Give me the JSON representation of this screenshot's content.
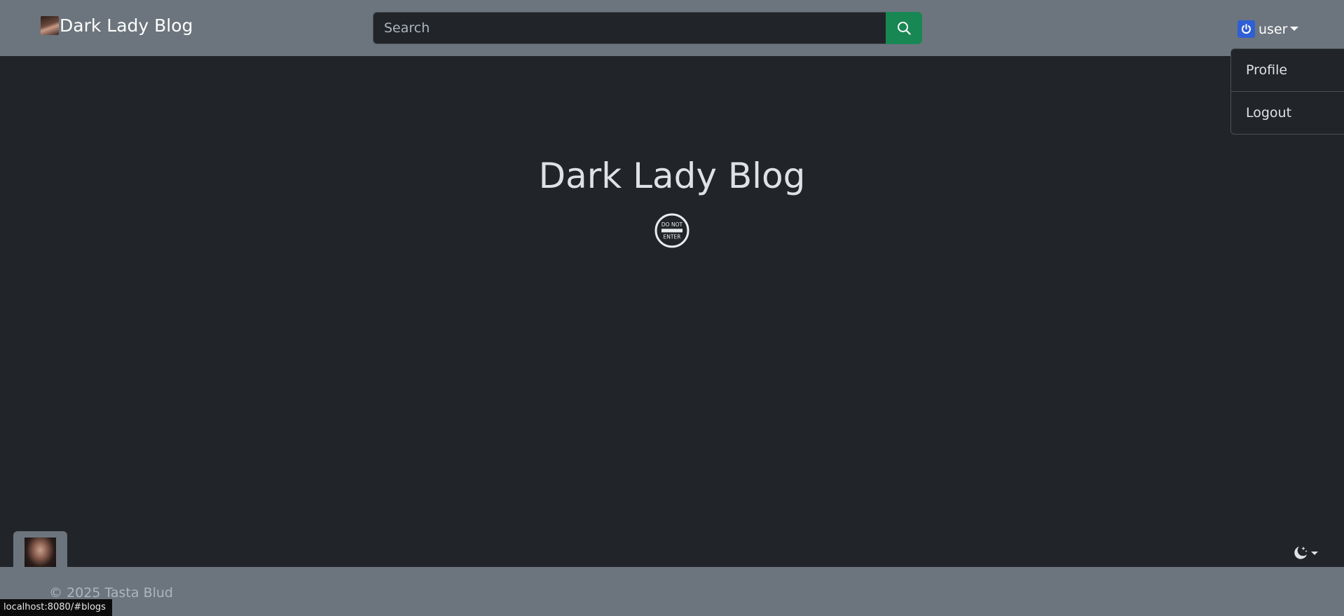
{
  "navbar": {
    "brand_text": "Dark Lady Blog",
    "search_placeholder": "Search",
    "search_icon": "search-icon",
    "user_label": "user",
    "user_icon": "power-icon"
  },
  "user_menu": {
    "items": [
      {
        "label": "Profile"
      },
      {
        "label": "Logout"
      }
    ]
  },
  "main": {
    "title": "Dark Lady Blog",
    "sign_text_top": "DO NOT",
    "sign_text_bottom": "ENTER"
  },
  "theme_toggle": {
    "icon": "moon-stars-icon"
  },
  "footer": {
    "copyright": "© 2025 Tasta Blud"
  },
  "status_bar": {
    "url": "localhost:8080/#blogs"
  },
  "colors": {
    "navbar_bg": "#6c757d",
    "body_bg": "#212529",
    "search_button": "#198754",
    "user_icon_bg": "#2f5fd6"
  }
}
